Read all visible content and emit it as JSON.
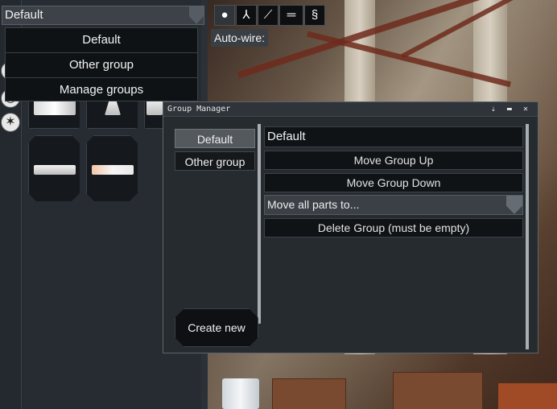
{
  "group_selector": {
    "selected": "Default",
    "options": [
      "Default",
      "Other group",
      "Manage groups"
    ]
  },
  "toolbar": {
    "icons": [
      "lightbulb-icon",
      "axes-icon",
      "wire-icon",
      "plumbing-icon",
      "spring-icon"
    ],
    "autowire_label": "Auto-wire:"
  },
  "side_icons": [
    "compass-icon",
    "circle-icon",
    "star-icon"
  ],
  "parts_count": 5,
  "group_manager": {
    "title": "Group Manager",
    "title_icons": "⇣ ▬ ✕",
    "groups": [
      "Default",
      "Other group"
    ],
    "selected_group": "Default",
    "name_value": "Default",
    "actions": {
      "move_up": "Move Group Up",
      "move_down": "Move Group Down",
      "move_parts_placeholder": "Move all parts to...",
      "delete": "Delete Group (must be empty)"
    },
    "create_label": "Create new"
  },
  "colors": {
    "panel_bg": "#262b30",
    "selected_bg": "#54595e",
    "button_bg": "#101316"
  }
}
